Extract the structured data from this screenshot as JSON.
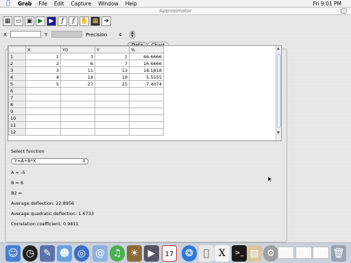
{
  "menubar": {
    "app_name": "Grab",
    "menus": [
      "File",
      "Edit",
      "Capture",
      "Window",
      "Help"
    ],
    "clock": "Fri 9:01 PM"
  },
  "window": {
    "title": "Approximator"
  },
  "toolbar": {
    "func1_label": "f",
    "func2_label": "f"
  },
  "params": {
    "x_label": "X",
    "x_value": "",
    "y_label": "Y",
    "precision_label": "Precision",
    "precision_value": "4"
  },
  "tabs": [
    "Data",
    "Chart"
  ],
  "table": {
    "columns": [
      "X",
      "Y0",
      "Y",
      "%"
    ],
    "rows": [
      {
        "row": "1",
        "x": "1",
        "y0": "3",
        "y": "1",
        "pct": "66.6666"
      },
      {
        "row": "2",
        "x": "2",
        "y0": "6",
        "y": "7",
        "pct": "16.6666"
      },
      {
        "row": "3",
        "x": "3",
        "y0": "11",
        "y": "13",
        "pct": "18.1818"
      },
      {
        "row": "4",
        "x": "4",
        "y0": "18",
        "y": "19",
        "pct": "5.5555"
      },
      {
        "row": "5",
        "x": "5",
        "y0": "27",
        "y": "25",
        "pct": "7.4074"
      },
      {
        "row": "6",
        "x": "",
        "y0": "",
        "y": "",
        "pct": ""
      },
      {
        "row": "7",
        "x": "",
        "y0": "",
        "y": "",
        "pct": ""
      },
      {
        "row": "8",
        "x": "",
        "y0": "",
        "y": "",
        "pct": ""
      },
      {
        "row": "9",
        "x": "",
        "y0": "",
        "y": "",
        "pct": ""
      },
      {
        "row": "10",
        "x": "",
        "y0": "",
        "y": "",
        "pct": ""
      },
      {
        "row": "11",
        "x": "",
        "y0": "",
        "y": "",
        "pct": ""
      },
      {
        "row": "12",
        "x": "",
        "y0": "",
        "y": "",
        "pct": ""
      }
    ]
  },
  "results": {
    "select_label": "Select function",
    "function_selected": "Y=A+B*X",
    "a": "A = -5",
    "b": "B = 6",
    "b2": "B2 =",
    "avg_deflection": "Average deflection: 22.8956",
    "avg_quad_deflection": "Average quadratic deflection: 1.6733",
    "correlation": "Correlation coefficient: 0.9811"
  },
  "dock": {
    "items": [
      "finder-icon",
      "clock-icon",
      "pencil-icon",
      "smiley-icon",
      "globe-icon",
      "mail-icon",
      "music-icon",
      "photo-icon",
      "movie-icon",
      "ical-icon",
      "safari-icon",
      "apple-icon",
      "x11-icon",
      "terminal-icon",
      "preview-icon",
      "pages-icon",
      "system-preferences-icon",
      "trash-icon"
    ],
    "ical_day": "17",
    "x11_letter": "X"
  },
  "colors": {
    "dock_bg": "#ccd2dc",
    "menubar_bg": "#f3f3f3",
    "accent": "#3a5a9c"
  }
}
